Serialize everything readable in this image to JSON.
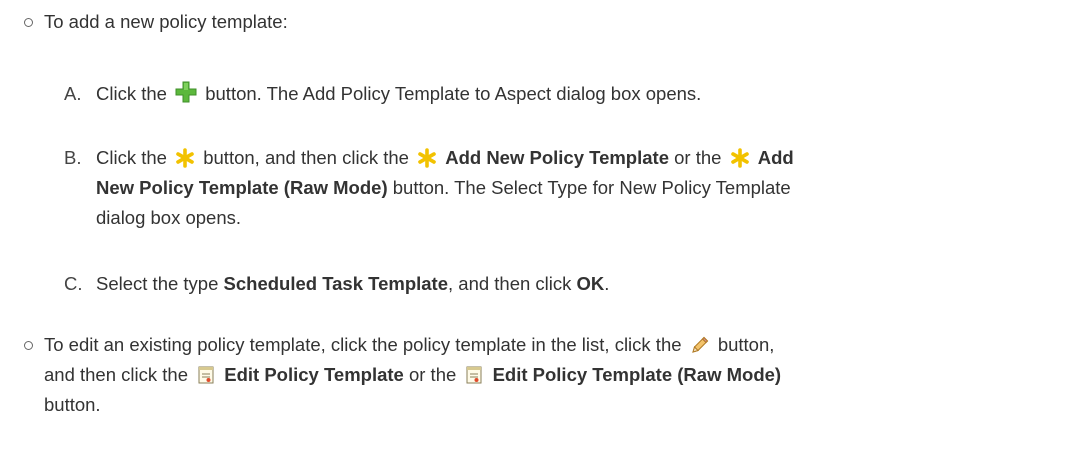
{
  "add": {
    "intro": "To add a new policy template:",
    "steps": {
      "a": {
        "marker": "A.",
        "pre": "Click the",
        "post": "button. The Add Policy Template to Aspect dialog box opens."
      },
      "b": {
        "marker": "B.",
        "pre": "Click the",
        "mid": "button, and then click the",
        "bold1": "Add New Policy Template",
        "or": "or the",
        "bold2a": "Add",
        "bold2b": "New Policy Template (Raw Mode)",
        "post1": "button. The Select Type for New Policy Template",
        "post2": "dialog box opens."
      },
      "c": {
        "marker": "C.",
        "pre": "Select the type",
        "bold1": "Scheduled Task Template",
        "mid": ", and then click",
        "bold2": "OK",
        "end": "."
      }
    }
  },
  "edit": {
    "line1_pre": "To edit an existing policy template, click the policy template in the list, click the",
    "line1_post": "button,",
    "line2_pre": "and then click the",
    "bold1": "Edit Policy Template",
    "or": "or the",
    "bold2": "Edit Policy Template (Raw Mode)",
    "line3": "button."
  },
  "icons": {
    "add": "plus-icon",
    "new": "asterisk-icon",
    "edit": "pencil-icon",
    "template": "policy-template-icon"
  },
  "colors": {
    "plus_green": "#5cb83c",
    "asterisk_yellow": "#f2c200",
    "pencil_orange": "#e8a33c"
  }
}
